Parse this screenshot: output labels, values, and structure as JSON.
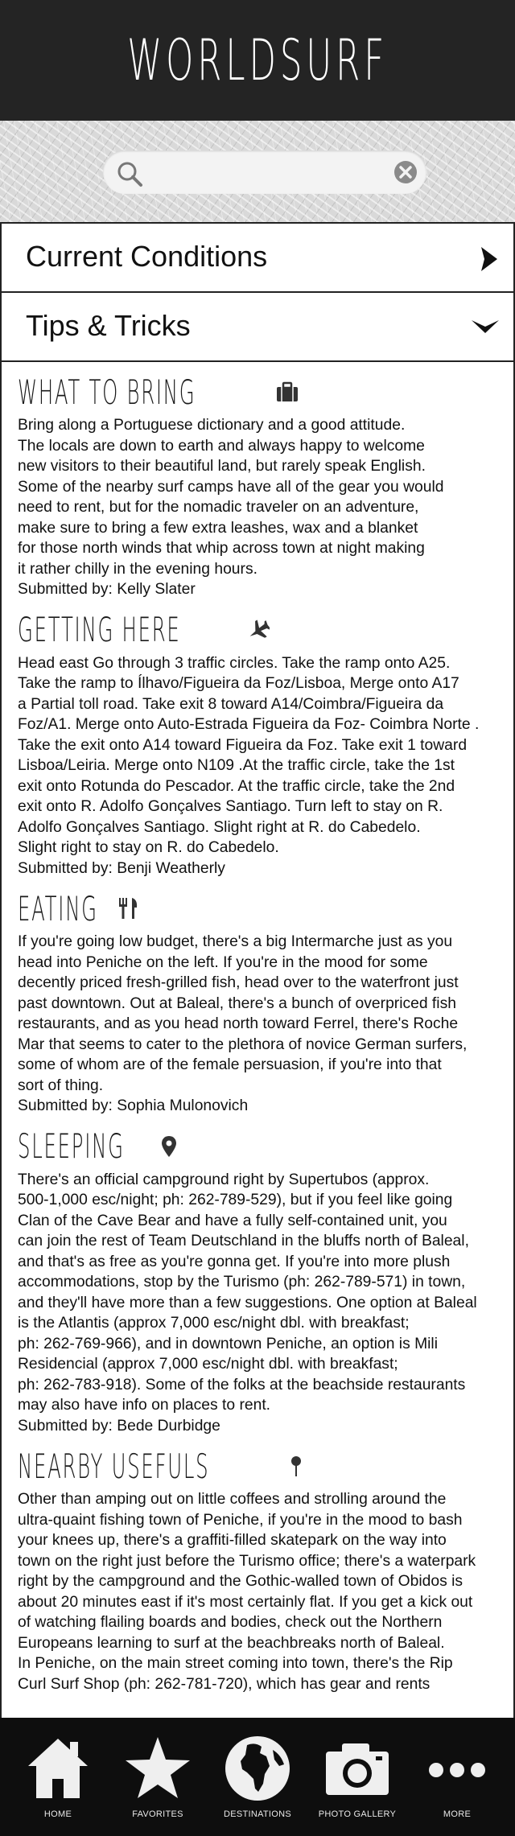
{
  "app": {
    "title": "WORLDSURF"
  },
  "search": {
    "placeholder": "",
    "value": ""
  },
  "accordion": {
    "current_conditions": "Current Conditions",
    "tips_and_tricks": "Tips & Tricks"
  },
  "sections": [
    {
      "title": "WHAT TO BRING",
      "icon": "briefcase-icon",
      "body": "Bring along a Portuguese dictionary and a good attitude.\nThe locals are down to earth and always happy to welcome\nnew visitors to their beautiful land, but rarely speak English.\nSome of the nearby surf camps have all of the gear you would\nneed to rent, but for the nomadic traveler on an adventure,\nmake sure to bring a few extra leashes, wax and a blanket\nfor those north winds that whip across town at night making\nit rather chilly in the evening hours.",
      "submitted": "Submitted by: Kelly Slater"
    },
    {
      "title": "GETTING HERE",
      "icon": "airplane-icon",
      "body": "Head east Go through 3 traffic circles. Take the ramp onto A25.\nTake the ramp to Ílhavo/Figueira da Foz/Lisboa, Merge onto A17\na Partial toll road. Take exit 8 toward A14/Coimbra/Figueira da\nFoz/A1. Merge onto Auto-Estrada Figueira da Foz- Coimbra Norte .\nTake the exit onto A14 toward Figueira da Foz. Take exit 1 toward\nLisboa/Leiria. Merge onto N109 .At the traffic circle, take the 1st\nexit onto Rotunda do Pescador. At the traffic circle, take the 2nd\nexit onto R. Adolfo Gonçalves Santiago. Turn left to stay on R.\nAdolfo Gonçalves Santiago. Slight right at R. do Cabedelo.\nSlight right to stay on R. do Cabedelo.",
      "submitted": "Submitted by: Benji Weatherly"
    },
    {
      "title": "EATING",
      "icon": "fork-knife-icon",
      "body": "If you're going low budget, there's a big Intermarche just as you\nhead into Peniche on the left. If you're in the mood for some\ndecently priced fresh-grilled fish, head over to the waterfront just\npast downtown. Out at Baleal, there's a bunch of overpriced fish\nrestaurants, and as you head north toward Ferrel, there's Roche\n Mar that seems to cater to the plethora of novice German surfers,\nsome of whom are of the female persuasion, if you're into that\nsort of thing.",
      "submitted": "Submitted by: Sophia Mulonovich"
    },
    {
      "title": "SLEEPING",
      "icon": "map-pin-icon",
      "body": "There's an official campground right by Supertubos (approx.\n500-1,000 esc/night; ph: 262-789-529), but if you feel like going\nClan of the Cave Bear and have a fully self-contained unit, you\ncan join the rest of Team Deutschland in the bluffs north of Baleal,\nand that's as free as you're gonna get. If you're into more plush\naccommodations, stop by the Turismo (ph: 262-789-571) in town,\nand they'll have more than a few suggestions. One option at Baleal\nis the Atlantis (approx 7,000 esc/night dbl. with breakfast;\nph: 262-769-966), and in downtown Peniche, an option is Mili\nResidencial (approx 7,000 esc/night dbl. with breakfast;\nph: 262-783-918). Some of the folks at the beachside restaurants\nmay also have info on places to rent.",
      "submitted": "Submitted by: Bede Durbidge"
    },
    {
      "title": "NEARBY USEFULS",
      "icon": "pushpin-icon",
      "body": "Other than amping out on little coffees and strolling around the\nultra-quaint fishing town of Peniche, if you're in the mood to bash\nyour knees up, there's a graffiti-filled skatepark on the way into\ntown on the right just before the Turismo office; there's a waterpark\n right by the campground and the Gothic-walled town of Obidos is\nabout 20 minutes east if it's most certainly flat. If you get a kick out\nof watching flailing boards and bodies, check out the Northern\nEuropeans learning to surf at the beachbreaks north of Baleal.\nIn Peniche, on the main street coming into town, there's the Rip\nCurl Surf Shop (ph: 262-781-720), which has gear and rents",
      "submitted": ""
    }
  ],
  "tabbar": [
    {
      "label": "HOME",
      "icon": "home-icon"
    },
    {
      "label": "FAVORITES",
      "icon": "star-icon"
    },
    {
      "label": "DESTINATIONS",
      "icon": "globe-icon"
    },
    {
      "label": "PHOTO GALLERY",
      "icon": "camera-icon"
    },
    {
      "label": "MORE",
      "icon": "more-dots-icon"
    }
  ],
  "colors": {
    "header_bg": "#242424",
    "tabbar_bg": "#0e0e0e",
    "search_band": "#d9d9d9"
  }
}
